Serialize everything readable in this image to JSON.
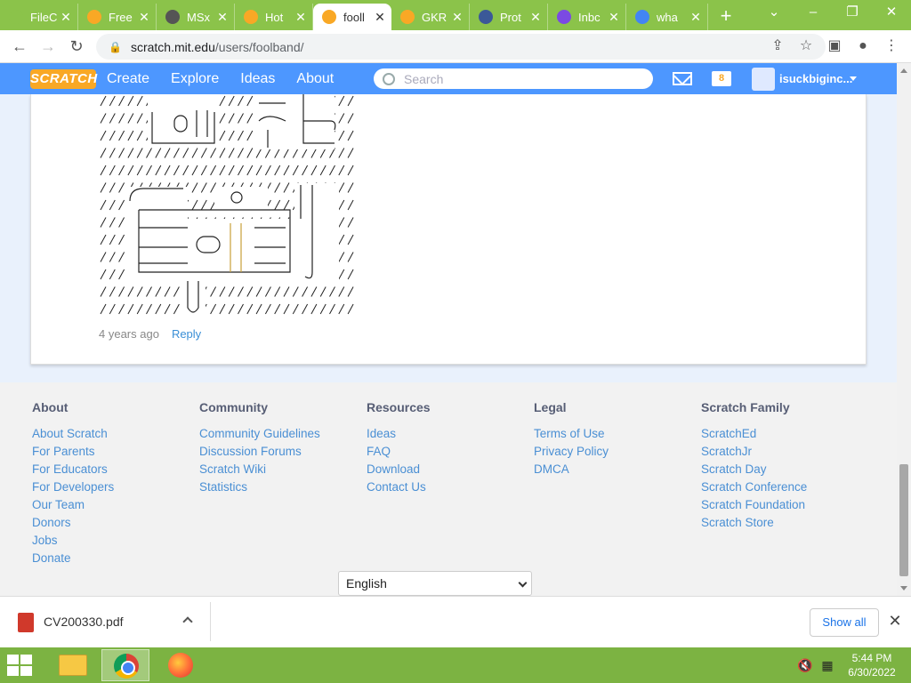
{
  "browser": {
    "tabs": [
      {
        "title": "FileC",
        "icon": "filec-tab-icon",
        "color": "#8bc34a",
        "active": false
      },
      {
        "title": "Free",
        "icon": "scratch-tab-icon",
        "color": "#f9a825",
        "active": false
      },
      {
        "title": "MSx",
        "icon": "globe-tab-icon",
        "color": "#555555",
        "active": false
      },
      {
        "title": "Hot",
        "icon": "scratch-tab-icon",
        "color": "#f9a825",
        "active": false
      },
      {
        "title": "fooll",
        "icon": "scratch-tab-icon",
        "color": "#f9a825",
        "active": true
      },
      {
        "title": "GKR",
        "icon": "scratch-tab-icon",
        "color": "#f9a825",
        "active": false
      },
      {
        "title": "Prot",
        "icon": "paypal-tab-icon",
        "color": "#3b5998",
        "active": false
      },
      {
        "title": "Inbc",
        "icon": "mail-tab-icon",
        "color": "#7b4ae2",
        "active": false
      },
      {
        "title": "wha",
        "icon": "google-tab-icon",
        "color": "#4285f4",
        "active": false
      }
    ],
    "url": {
      "host": "scratch.mit.edu",
      "path": "/users/foolband/"
    }
  },
  "scratch_nav": {
    "logo": "SCRATCH",
    "items": [
      "Create",
      "Explore",
      "Ideas",
      "About"
    ],
    "search_placeholder": "Search",
    "username": "isuckbiginc..."
  },
  "comment": {
    "time": "4 years ago",
    "reply_label": "Reply"
  },
  "footer": {
    "columns": [
      {
        "heading": "About",
        "links": [
          "About Scratch",
          "For Parents",
          "For Educators",
          "For Developers",
          "Our Team",
          "Donors",
          "Jobs",
          "Donate"
        ]
      },
      {
        "heading": "Community",
        "links": [
          "Community Guidelines",
          "Discussion Forums",
          "Scratch Wiki",
          "Statistics"
        ]
      },
      {
        "heading": "Resources",
        "links": [
          "Ideas",
          "FAQ",
          "Download",
          "Contact Us"
        ]
      },
      {
        "heading": "Legal",
        "links": [
          "Terms of Use",
          "Privacy Policy",
          "DMCA"
        ]
      },
      {
        "heading": "Scratch Family",
        "links": [
          "ScratchEd",
          "ScratchJr",
          "Scratch Day",
          "Scratch Conference",
          "Scratch Foundation",
          "Scratch Store"
        ]
      }
    ],
    "language": "English"
  },
  "download_bar": {
    "filename": "CV200330.pdf",
    "show_all": "Show all"
  },
  "taskbar": {
    "time": "5:44 PM",
    "date": "6/30/2022"
  },
  "colors": {
    "scratch_blue": "#4d97ff",
    "tabstrip_green": "#8bc34a",
    "taskbar_green": "#7cb342",
    "link_blue": "#4a8fd4"
  }
}
